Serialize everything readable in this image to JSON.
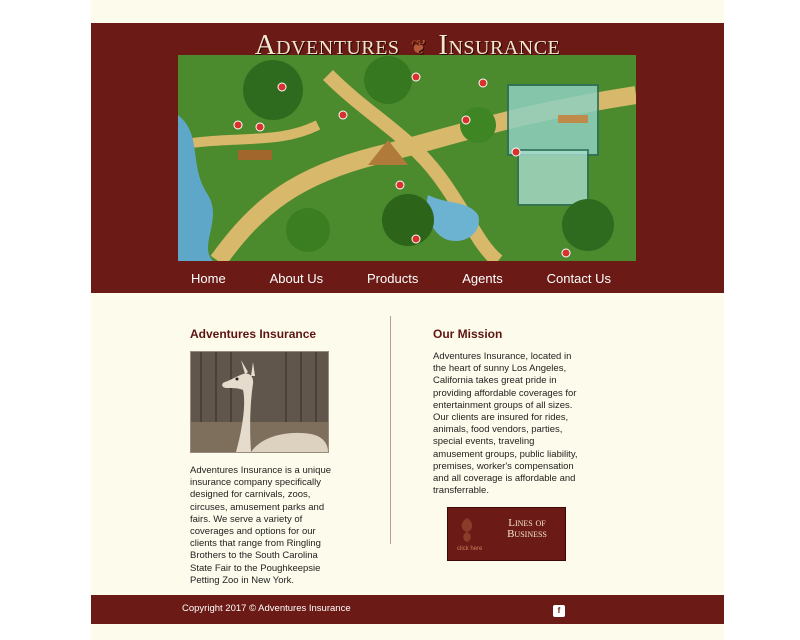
{
  "header": {
    "title_left": "Adventures",
    "title_right": "Insurance"
  },
  "nav": [
    {
      "label": "Home"
    },
    {
      "label": "About Us"
    },
    {
      "label": "Products"
    },
    {
      "label": "Agents"
    },
    {
      "label": "Contact Us"
    }
  ],
  "left_column": {
    "heading": "Adventures Insurance",
    "body": "Adventures Insurance is a unique insurance company specifically designed for carnivals, zoos, circuses, amusement parks and fairs. We serve a variety of coverages and options for our clients that range from Ringling Brothers to the South Carolina State Fair to the Poughkeepsie Petting Zoo in New York."
  },
  "right_column": {
    "heading": "Our Mission",
    "body": "Adventures Insurance, located in the heart of sunny Los Angeles, California takes great pride in providing affordable coverages for entertainment groups of all sizes. Our clients are insured for rides, animals, food vendors, parties, special events, traveling amusement groups, public liability, premises, worker's compensation and all coverage is affordable and transferrable."
  },
  "lines_button": {
    "title": "Lines of Business",
    "click": "click here"
  },
  "footer": {
    "copyright": "Copyright 2017 © Adventures Insurance",
    "facebook": "f"
  },
  "colors": {
    "brand": "#6b1a15",
    "page_background": "#fdfbeb",
    "heading": "#5e1512"
  }
}
